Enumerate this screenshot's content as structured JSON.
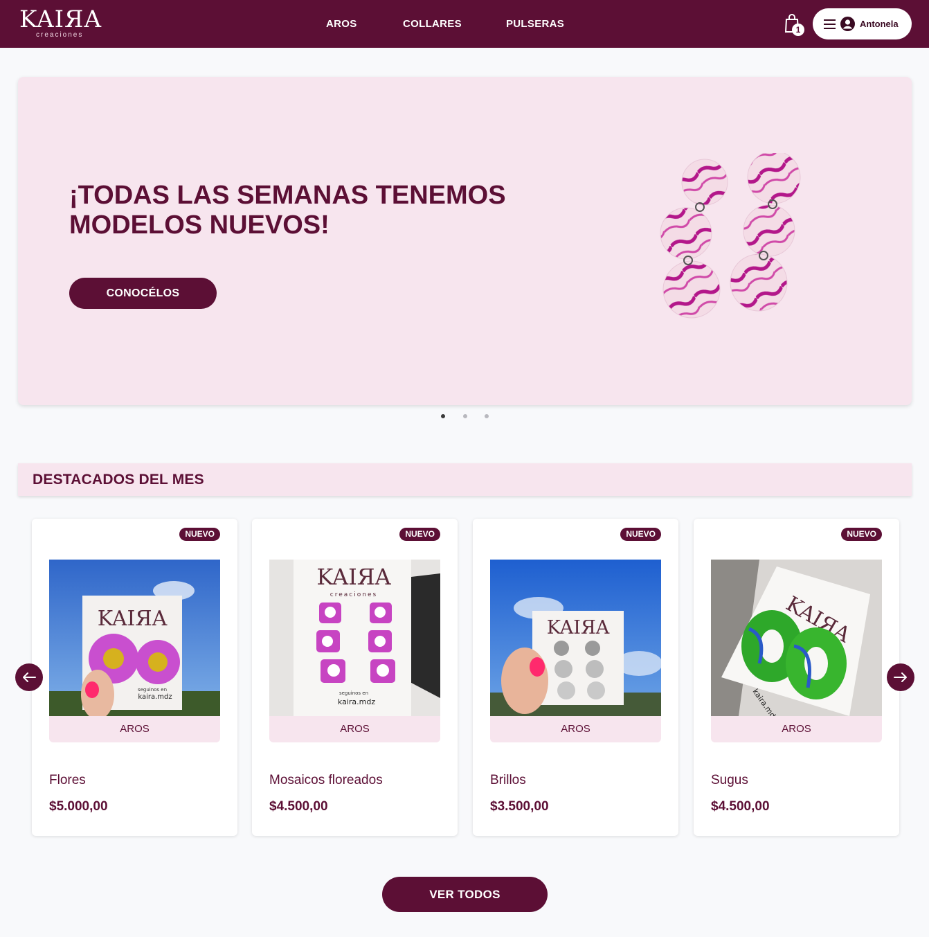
{
  "brand": {
    "name": "KAIЯA",
    "tagline": "creaciones"
  },
  "nav": {
    "items": [
      "AROS",
      "COLLARES",
      "PULSERAS"
    ]
  },
  "cart": {
    "count": "1"
  },
  "user": {
    "name": "Antonela"
  },
  "hero": {
    "title": "¡TODAS LAS SEMANAS TENEMOS MODELOS NUEVOS!",
    "cta": "CONOCÉLOS",
    "slides": 3,
    "active_slide": 1
  },
  "featured": {
    "title": "DESTACADOS DEL MES",
    "products": [
      {
        "badge": "NUEVO",
        "category": "AROS",
        "name": "Flores",
        "price": "$5.000,00"
      },
      {
        "badge": "NUEVO",
        "category": "AROS",
        "name": "Mosaicos floreados",
        "price": "$4.500,00"
      },
      {
        "badge": "NUEVO",
        "category": "AROS",
        "name": "Brillos",
        "price": "$3.500,00"
      },
      {
        "badge": "NUEVO",
        "category": "AROS",
        "name": "Sugus",
        "price": "$4.500,00"
      }
    ],
    "photo_texts": {
      "card_brand": "KAIЯA",
      "card_tagline": "creaciones",
      "follow": "seguinos en",
      "handle": "kaira.mdz"
    }
  },
  "cta_all": "VER TODOS",
  "colors": {
    "primary": "#5c0f35",
    "soft_pink": "#f7e5ee",
    "background": "#f8f9fb"
  },
  "icons": [
    "shopping-bag-icon",
    "hamburger-menu-icon",
    "user-circle-icon",
    "arrow-left-icon",
    "arrow-right-icon"
  ]
}
